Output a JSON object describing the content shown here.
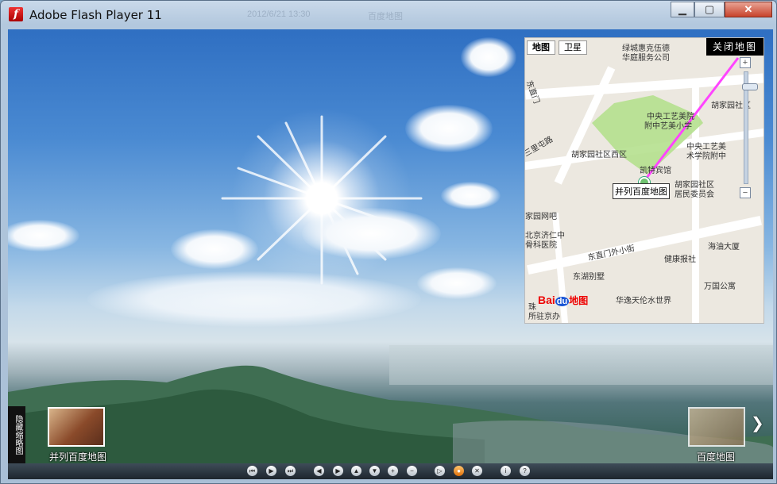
{
  "window": {
    "title": "Adobe Flash Player 11",
    "ghost_left": "2012/6/21 13:30",
    "ghost_right": "百度地图",
    "min_icon": "minimize-icon",
    "max_icon": "maximize-icon",
    "close_icon": "close-icon"
  },
  "map": {
    "tab_map": "地图",
    "tab_satellite": "卫星",
    "close_label": "关闭地图",
    "marker_label": "并列百度地图",
    "logo_bai": "Bai",
    "logo_du": "du",
    "logo_suffix": "地图",
    "pois": [
      "绿城惠克伍德",
      "华庭服务公司",
      "中央工艺美院",
      "附中艺美小学",
      "胡家园社区",
      "中央工艺美",
      "术学院附中",
      "胡家园社区西区",
      "凯特宾馆",
      "胡家园社区",
      "居民委员会",
      "家园网吧",
      "北京济仁中",
      "骨科医院",
      "东直门外小街",
      "海油大厦",
      "健康报社",
      "东湖别墅",
      "万国公寓",
      "华逸天伦水世界",
      "珠",
      "所驻京办",
      "东直门",
      "三里屯路"
    ]
  },
  "thumbs": {
    "left_caption": "并列百度地图",
    "right_caption": "百度地图"
  },
  "side_tab": "隐藏缩略图",
  "controls": [
    "skip-back-icon",
    "play-icon",
    "skip-forward-icon",
    "arrow-left-icon",
    "arrow-right-icon",
    "arrow-up-icon",
    "arrow-down-icon",
    "zoom-in-icon",
    "zoom-out-icon",
    "autoplay-icon",
    "record-icon",
    "fullscreen-icon",
    "info-icon",
    "help-icon"
  ],
  "colors": {
    "accent": "#e0700a",
    "park": "#b5e08e",
    "link_line": "#ff44ff"
  }
}
